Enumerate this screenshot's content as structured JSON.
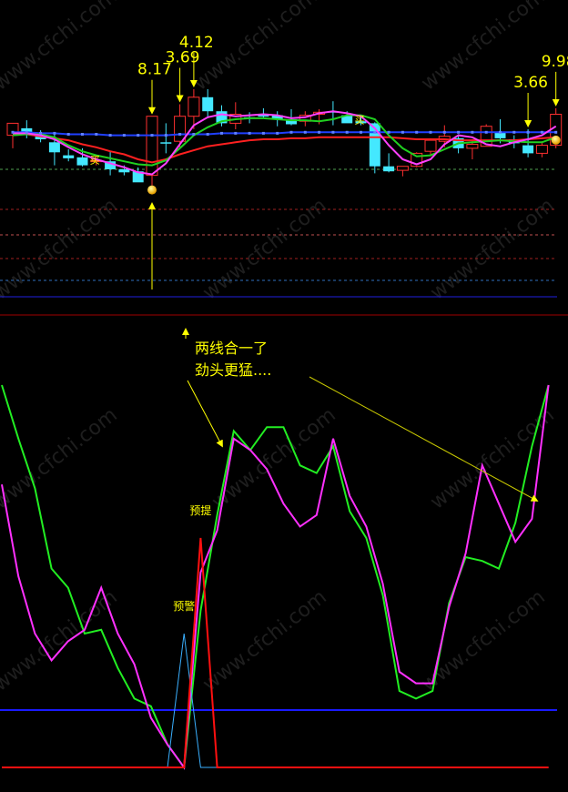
{
  "colors": {
    "background": "#000000",
    "up_candle": "#ff3030",
    "down_candle": "#44e8ff",
    "ma_red": "#ff2020",
    "ma_green": "#20d020",
    "ma_magenta": "#ff40ff",
    "ma_blue": "#2040ff",
    "signal_yellow": "#ffff00",
    "osc_green": "#22ee22",
    "osc_magenta": "#ff30ff",
    "osc_cyan": "#3ab0ff",
    "osc_red": "#ff1010",
    "osc_baseline_blue": "#1a1aff"
  },
  "watermark_text": "www.cfchi.com",
  "chart_data": [
    {
      "type": "candlestick",
      "panel": "price",
      "title": "",
      "candles": [
        {
          "o": 4.6,
          "h": 4.2,
          "l": 5.9,
          "c": 3.4
        },
        {
          "o": 3.9,
          "h": 3.1,
          "l": 4.9,
          "c": 4.3
        },
        {
          "o": 4.6,
          "h": 4.1,
          "l": 5.3,
          "c": 5.0
        },
        {
          "o": 5.3,
          "h": 4.4,
          "l": 7.6,
          "c": 6.3
        },
        {
          "o": 6.6,
          "h": 6.0,
          "l": 7.2,
          "c": 6.9
        },
        {
          "o": 6.8,
          "h": 5.9,
          "l": 7.7,
          "c": 7.6
        },
        {
          "o": 7.2,
          "h": 6.6,
          "l": 7.6,
          "c": 7.1
        },
        {
          "o": 7.2,
          "h": 6.2,
          "l": 8.6,
          "c": 8.0
        },
        {
          "o": 8.0,
          "h": 7.6,
          "l": 8.6,
          "c": 8.3
        },
        {
          "o": 8.2,
          "h": 7.8,
          "l": 9.0,
          "c": 9.3
        },
        {
          "o": 8.6,
          "h": 2.7,
          "l": 9.6,
          "c": 2.7
        },
        {
          "o": 5.3,
          "h": 3.4,
          "l": 6.4,
          "c": 5.3
        },
        {
          "o": 5.2,
          "h": 1.5,
          "l": 5.8,
          "c": 2.7
        },
        {
          "o": 2.7,
          "h": 0.0,
          "l": 4.0,
          "c": 0.8
        },
        {
          "o": 0.8,
          "h": 0.0,
          "l": 2.9,
          "c": 2.2
        },
        {
          "o": 2.2,
          "h": 1.6,
          "l": 3.7,
          "c": 3.4
        },
        {
          "o": 3.4,
          "h": 1.3,
          "l": 4.0,
          "c": 2.5
        },
        {
          "o": 2.8,
          "h": 2.3,
          "l": 3.4,
          "c": 2.9
        },
        {
          "o": 2.6,
          "h": 1.9,
          "l": 2.9,
          "c": 2.6
        },
        {
          "o": 2.6,
          "h": 2.2,
          "l": 3.7,
          "c": 3.0
        },
        {
          "o": 3.0,
          "h": 2.0,
          "l": 3.6,
          "c": 3.5
        },
        {
          "o": 3.2,
          "h": 2.2,
          "l": 3.7,
          "c": 2.6
        },
        {
          "o": 2.5,
          "h": 2.0,
          "l": 3.5,
          "c": 2.3
        },
        {
          "o": 2.2,
          "h": 1.2,
          "l": 3.6,
          "c": 2.3
        },
        {
          "o": 2.6,
          "h": 2.2,
          "l": 3.2,
          "c": 3.4
        },
        {
          "o": 3.2,
          "h": 2.8,
          "l": 3.6,
          "c": 3.4
        },
        {
          "o": 3.4,
          "h": 3.3,
          "l": 8.4,
          "c": 7.7
        },
        {
          "o": 7.7,
          "h": 6.4,
          "l": 8.3,
          "c": 8.2
        },
        {
          "o": 8.1,
          "h": 7.7,
          "l": 8.7,
          "c": 7.7
        },
        {
          "o": 7.7,
          "h": 6.3,
          "l": 7.8,
          "c": 6.4
        },
        {
          "o": 6.2,
          "h": 4.9,
          "l": 6.7,
          "c": 5.1
        },
        {
          "o": 5.2,
          "h": 3.6,
          "l": 5.8,
          "c": 4.7
        },
        {
          "o": 4.9,
          "h": 4.5,
          "l": 6.4,
          "c": 5.9
        },
        {
          "o": 5.9,
          "h": 5.0,
          "l": 7.0,
          "c": 5.5
        },
        {
          "o": 5.7,
          "h": 3.5,
          "l": 5.5,
          "c": 3.7
        },
        {
          "o": 4.3,
          "h": 3.0,
          "l": 5.4,
          "c": 4.9
        },
        {
          "o": 5.0,
          "h": 4.6,
          "l": 5.9,
          "c": 5.4
        },
        {
          "o": 5.6,
          "h": 4.0,
          "l": 6.8,
          "c": 6.4
        },
        {
          "o": 6.4,
          "h": 5.2,
          "l": 6.8,
          "c": 5.6
        },
        {
          "o": 5.6,
          "h": 1.9,
          "l": 5.9,
          "c": 2.5
        }
      ],
      "moving_averages": [
        {
          "color": "ma_blue",
          "values": [
            4.3,
            4.3,
            4.4,
            4.4,
            4.5,
            4.5,
            4.5,
            4.6,
            4.6,
            4.6,
            4.6,
            4.6,
            4.5,
            4.5,
            4.5,
            4.4,
            4.4,
            4.4,
            4.4,
            4.4,
            4.3,
            4.3,
            4.3,
            4.3,
            4.3,
            4.3,
            4.3,
            4.3,
            4.3,
            4.3,
            4.3,
            4.3,
            4.3,
            4.3,
            4.3,
            4.3,
            4.3,
            4.3,
            4.3,
            4.3
          ]
        },
        {
          "color": "ma_red",
          "values": [
            4.5,
            4.5,
            4.7,
            4.9,
            5.1,
            5.5,
            5.8,
            6.2,
            6.5,
            7.0,
            7.3,
            7.0,
            6.5,
            6.1,
            5.7,
            5.5,
            5.3,
            5.1,
            5.0,
            5.0,
            4.9,
            4.9,
            4.8,
            4.8,
            4.8,
            4.8,
            4.8,
            4.8,
            4.9,
            5.0,
            5.0,
            5.0,
            5.1,
            5.1,
            5.1,
            5.1,
            5.1,
            5.0,
            4.9,
            4.8
          ]
        },
        {
          "color": "ma_green",
          "values": [
            4.6,
            4.5,
            4.5,
            4.8,
            5.6,
            6.2,
            6.6,
            6.9,
            7.2,
            7.5,
            7.6,
            7.1,
            5.9,
            4.6,
            3.8,
            3.2,
            3.0,
            2.9,
            2.9,
            3.0,
            3.1,
            3.1,
            3.2,
            3.0,
            2.6,
            2.6,
            3.0,
            4.6,
            5.9,
            6.7,
            6.6,
            6.0,
            5.4,
            5.3,
            5.2,
            5.1,
            5.2,
            5.3,
            5.3,
            4.8
          ]
        },
        {
          "color": "ma_magenta",
          "values": [
            4.4,
            4.4,
            4.6,
            5.0,
            5.8,
            6.5,
            7.0,
            7.4,
            7.8,
            8.3,
            8.5,
            7.4,
            5.5,
            3.6,
            2.8,
            2.5,
            2.7,
            2.6,
            2.5,
            2.6,
            2.9,
            2.8,
            2.4,
            2.2,
            2.4,
            2.7,
            3.9,
            5.6,
            7.0,
            7.5,
            7.0,
            5.5,
            4.6,
            4.8,
            5.5,
            5.7,
            5.3,
            5.0,
            4.6,
            3.7
          ]
        }
      ],
      "labels": [
        {
          "text": "8.17",
          "candle": 10
        },
        {
          "text": "3.69",
          "candle": 12
        },
        {
          "text": "4.12",
          "candle": 13
        },
        {
          "text": "3.66",
          "candle": 37
        },
        {
          "text": "9.98",
          "candle": 39
        }
      ],
      "buy_marks": [
        {
          "text": "买",
          "candle": 6
        },
        {
          "text": "买",
          "candle": 25
        }
      ]
    },
    {
      "type": "line",
      "panel": "oscillator",
      "x": [
        0,
        1,
        2,
        3,
        4,
        5,
        6,
        7,
        8,
        9,
        10,
        11,
        12,
        13,
        14,
        15,
        16,
        17,
        18,
        19,
        20,
        21,
        22,
        23,
        24,
        25,
        26,
        27,
        28,
        29,
        30,
        31,
        32,
        33
      ],
      "series": [
        {
          "color": "osc_green",
          "values": [
            100,
            86,
            73,
            52,
            47,
            35,
            36,
            26,
            18,
            16,
            6,
            0,
            41,
            66,
            88,
            83,
            89,
            89,
            79,
            77,
            84,
            67,
            60,
            45,
            20,
            18,
            20,
            43,
            55,
            54,
            52,
            64,
            84,
            100
          ]
        },
        {
          "color": "osc_magenta",
          "values": [
            74,
            50,
            35,
            28,
            33,
            36,
            47,
            35,
            27,
            13,
            6,
            0,
            51,
            62,
            86,
            83,
            78,
            69,
            63,
            66,
            86,
            71,
            63,
            48,
            25,
            22,
            22,
            42,
            56,
            79,
            69,
            59,
            65,
            100
          ]
        },
        {
          "color": "osc_cyan",
          "values": [
            0,
            0,
            0,
            0,
            0,
            0,
            0,
            0,
            0,
            0,
            0,
            35,
            0,
            0,
            0,
            0,
            0,
            0,
            0,
            0,
            0,
            0,
            0,
            0,
            0,
            0,
            0,
            0,
            0,
            0,
            0,
            0,
            0,
            0
          ]
        },
        {
          "color": "osc_red",
          "values": [
            0,
            0,
            0,
            0,
            0,
            0,
            0,
            0,
            0,
            0,
            0,
            0,
            60,
            0,
            0,
            0,
            0,
            0,
            0,
            0,
            0,
            0,
            0,
            0,
            0,
            0,
            0,
            0,
            0,
            0,
            0,
            0,
            0,
            0
          ]
        }
      ],
      "horizontal_lines": [
        {
          "color": "osc_baseline_blue",
          "level": 15
        }
      ],
      "signal_labels": [
        {
          "text": "预提",
          "x": 12
        },
        {
          "text": "预警",
          "x": 11
        }
      ],
      "annotation": {
        "lines": [
          "两线合一了",
          "劲头更猛...."
        ]
      }
    }
  ]
}
